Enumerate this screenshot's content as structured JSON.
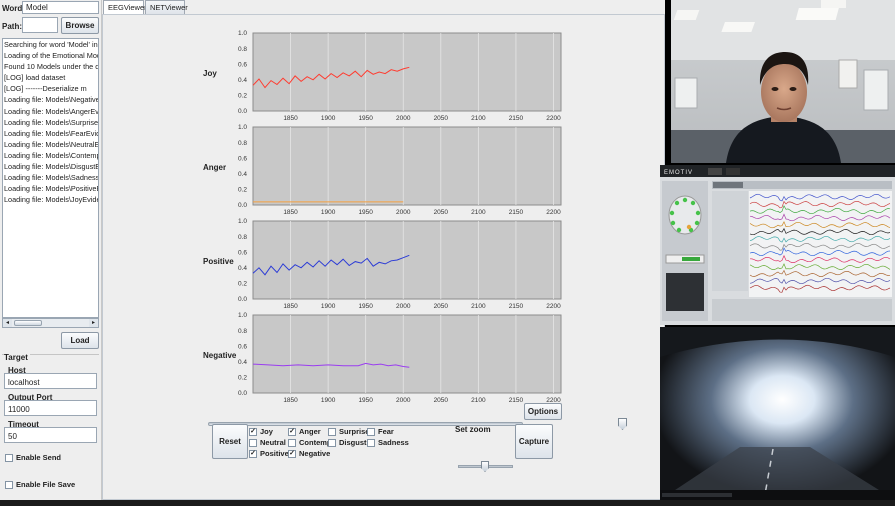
{
  "left_panel": {
    "word_label": "Word:",
    "word_value": "Model",
    "path_label": "Path:",
    "path_value": "",
    "browse_label": "Browse",
    "log_lines": [
      "Searching for word 'Model' in text file",
      "Loading of the Emotional Models s",
      "Found 10 Models under the director",
      "[LOG]          load dataset",
      "[LOG]          -------Deserialize m",
      "Loading file: Models\\NegativeEvider",
      "Loading file: Models\\AngerEvidence",
      "Loading file: Models\\SurpriseEviden",
      "Loading file: Models\\FearEvidence_",
      "Loading file: Models\\NeutralEvidenc",
      "Loading file: Models\\ContemptEvide",
      "Loading file: Models\\DisgustEviden",
      "Loading file: Models\\SadnessEvide",
      "Loading file: Models\\PositiveEviden",
      "Loading file: Models\\JoyEvidence_F"
    ],
    "load_label": "Load",
    "target_label": "Target",
    "host_label": "Host",
    "host_value": "localhost",
    "port_label": "Output Port",
    "port_value": "11000",
    "timeout_label": "Timeout",
    "timeout_value": "50",
    "enable_send_label": "Enable Send",
    "enable_file_save_label": "Enable File Save"
  },
  "tabs": [
    {
      "label": "EEGViewer",
      "active": true
    },
    {
      "label": "NETViewer",
      "active": false
    }
  ],
  "chart_data": [
    {
      "type": "line",
      "label": "Joy",
      "color": "#ff3b2f",
      "xlim": [
        1800,
        2210
      ],
      "ylim": [
        0,
        1.0
      ],
      "xticks": [
        1850,
        1900,
        1950,
        2000,
        2050,
        2100,
        2150,
        2200
      ],
      "yticks": [
        "0.0",
        "0.2",
        "0.4",
        "0.6",
        "0.8",
        "1.0"
      ],
      "x": [
        1800,
        1808,
        1816,
        1824,
        1832,
        1840,
        1848,
        1856,
        1864,
        1872,
        1880,
        1888,
        1896,
        1904,
        1912,
        1920,
        1928,
        1936,
        1944,
        1952,
        1960,
        1968,
        1976,
        1984,
        1992,
        2000,
        2008
      ],
      "y": [
        0.33,
        0.41,
        0.3,
        0.39,
        0.34,
        0.42,
        0.35,
        0.45,
        0.38,
        0.44,
        0.4,
        0.47,
        0.41,
        0.48,
        0.43,
        0.49,
        0.45,
        0.51,
        0.44,
        0.52,
        0.47,
        0.5,
        0.48,
        0.53,
        0.51,
        0.54,
        0.56
      ]
    },
    {
      "type": "line",
      "label": "Anger",
      "color": "#f5a040",
      "xlim": [
        1800,
        2210
      ],
      "ylim": [
        0,
        1.0
      ],
      "xticks": [
        1850,
        1900,
        1950,
        2000,
        2050,
        2100,
        2150,
        2200
      ],
      "yticks": [
        "0.0",
        "0.2",
        "0.4",
        "0.6",
        "0.8",
        "1.0"
      ],
      "x": [
        1800,
        2000
      ],
      "y": [
        0.04,
        0.04
      ]
    },
    {
      "type": "line",
      "label": "Positive",
      "color": "#2b3bd6",
      "xlim": [
        1800,
        2210
      ],
      "ylim": [
        0,
        1.0
      ],
      "xticks": [
        1850,
        1900,
        1950,
        2000,
        2050,
        2100,
        2150,
        2200
      ],
      "yticks": [
        "0.0",
        "0.2",
        "0.4",
        "0.6",
        "0.8",
        "1.0"
      ],
      "x": [
        1800,
        1808,
        1816,
        1824,
        1832,
        1840,
        1848,
        1856,
        1864,
        1872,
        1880,
        1888,
        1896,
        1904,
        1912,
        1920,
        1928,
        1936,
        1944,
        1952,
        1960,
        1968,
        1976,
        1984,
        1992,
        2000,
        2008
      ],
      "y": [
        0.33,
        0.4,
        0.31,
        0.42,
        0.34,
        0.45,
        0.37,
        0.44,
        0.4,
        0.47,
        0.41,
        0.49,
        0.42,
        0.5,
        0.44,
        0.51,
        0.43,
        0.48,
        0.46,
        0.52,
        0.42,
        0.47,
        0.45,
        0.49,
        0.5,
        0.53,
        0.56
      ]
    },
    {
      "type": "line",
      "label": "Negative",
      "color": "#9a3df0",
      "xlim": [
        1800,
        2210
      ],
      "ylim": [
        0,
        1.0
      ],
      "xticks": [
        1850,
        1900,
        1950,
        2000,
        2050,
        2100,
        2150,
        2200
      ],
      "yticks": [
        "0.0",
        "0.2",
        "0.4",
        "0.6",
        "0.8",
        "1.0"
      ],
      "x": [
        1800,
        1820,
        1840,
        1860,
        1880,
        1900,
        1920,
        1940,
        1950,
        1960,
        1970,
        1980,
        1990,
        2000,
        2008
      ],
      "y": [
        0.37,
        0.36,
        0.35,
        0.36,
        0.35,
        0.36,
        0.35,
        0.35,
        0.38,
        0.36,
        0.37,
        0.35,
        0.36,
        0.34,
        0.33
      ]
    }
  ],
  "controls": {
    "options_label": "Options",
    "reset_label": "Reset",
    "capture_label": "Capture",
    "set_zoom_label": "Set zoom",
    "slider_position": 1.0,
    "zoom_position": 0.5,
    "emotions": [
      {
        "label": "Joy",
        "checked": true
      },
      {
        "label": "Neutral",
        "checked": false
      },
      {
        "label": "Positive",
        "checked": true
      },
      {
        "label": "Anger",
        "checked": true
      },
      {
        "label": "Contempt",
        "checked": false
      },
      {
        "label": "Negative",
        "checked": true
      },
      {
        "label": "Surprise",
        "checked": false
      },
      {
        "label": "Disgust",
        "checked": false
      },
      {
        "label": "Fear",
        "checked": false
      },
      {
        "label": "Sadness",
        "checked": false
      }
    ]
  },
  "emotiv": {
    "brand": "EMOTIV"
  }
}
